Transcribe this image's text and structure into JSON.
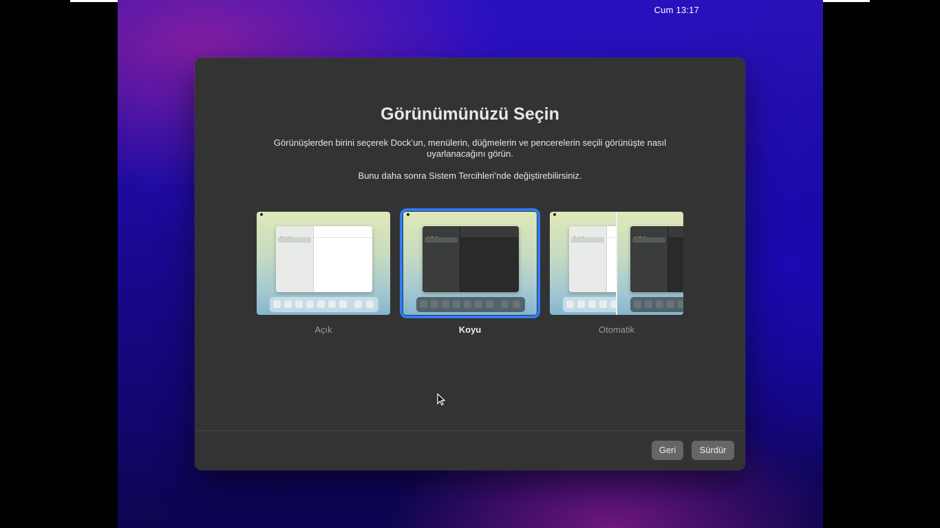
{
  "menubar": {
    "clock": "Cum 13:17"
  },
  "dialog": {
    "title": "Görünümünüzü Seçin",
    "description": "Görünüşlerden birini seçerek Dock’un, menülerin, düğmelerin ve pencerelerin seçili görünüşte nasıl uyarlanacağını görün.",
    "note": "Bunu daha sonra Sistem Tercihleri’nde değiştirebilirsiniz.",
    "options": [
      {
        "label": "Açık",
        "selected": false
      },
      {
        "label": "Koyu",
        "selected": true
      },
      {
        "label": "Otomatik",
        "selected": false
      }
    ],
    "buttons": {
      "back": "Geri",
      "continue": "Sürdür"
    }
  },
  "colors": {
    "dialog_bg": "#333333",
    "selection_outline": "#2f7cf6",
    "button_bg": "#666666"
  }
}
